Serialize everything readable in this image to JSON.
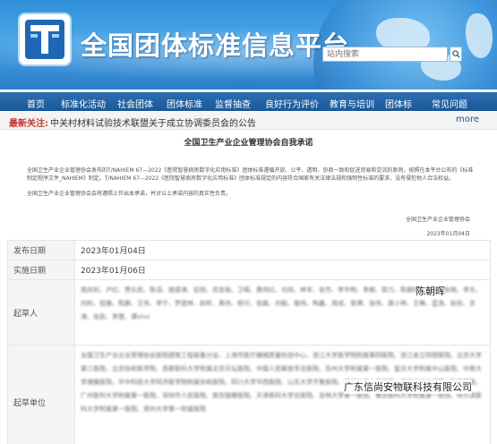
{
  "site": {
    "title": "全国团体标准信息平台",
    "search_placeholder": "站内搜索"
  },
  "nav": {
    "items": [
      "首页",
      "标准化活动",
      "社会团体",
      "团体标准",
      "监督抽查",
      "良好行为评价",
      "教育与培训",
      "团体标",
      "常见问题"
    ]
  },
  "notice": {
    "label": "最新关注:",
    "text": "中关村材料试验技术联盟关于成立协调委员会的公告",
    "more": "more"
  },
  "document": {
    "title": "全国卫生产业企业管理协会自我承诺",
    "paragraph1": "全国卫生产业企业管理协会发布的T/NAHIEM 67—2022《医院智慧病房数字化应用标准》团体标准遵循开放、公平、透明、协商一致和促进贸易和交流的原则，按照在本平台公布的《标准制定程序文件_NAHIEM》制定。T/NAHIEM 67—2022《医院智慧病房数字化应用标准》团体标准规定的内容符合国家有关法律法规和强制性标准的要求，没有侵犯他人合法权益。",
    "paragraph2": "全国卫生产业企业管理协会会将遵照上作出本承诺，并对以上承诺内容的真实性负责。",
    "signature": "全国卫生产业企业管理协会",
    "sign_date": "2023年01月04日"
  },
  "info": {
    "publish_label": "发布日期",
    "publish_date": "2023年01月04日",
    "implement_label": "实施日期",
    "implement_date": "2023年01月06日",
    "drafters_label": "起草人",
    "drafters_text": "周庆利、卢红、贾乐凯、陈滔、姚碧涛、彭刚、苏哲瑜、卫萌、黄伟红、刘凤、林军、张杰、李华明、李颖、郭力、陈朝晖、阚磊、赵晓、李东、刘利、倪雅、陈鹏、王伟、李宁、罗建林、赵昕、黄伟、杨可、张磊、刘毅、骆伟、陶鑫、周成、吴博、张伟、唐小林、王琳、蓝浩、赵彤、苏涛、张凯、李慧、谭vivv",
    "drafter_highlight": "陈朝晖",
    "units_label": "起草单位",
    "units_text": "全国卫生产业企业管理协会医院建筑工程装备分会、上海市医疗器械质量检验中心、浙江大学医学院附属第四医院、浙江省立同德医院、北京大学第三医院、北京协和医学院、首都医科大学附属北京天坛医院、中国人民解放军总医院、苏州大学附属第一医院、复旦大学附属中山医院、中南大学湘雅医院、华中科技大学同济医学院附属协和医院、四川大学华西医院、山东大学齐鲁医院、武汉大学人民医院、西安交通大学第一附属医院、广州医科大学附属第一医院、深圳市人民医院、南京鼓楼医院、天津医科大学总医院、吉林大学第一医院、重庆医科大学附属第一医院、哈尔滨医科大学附属第一医院、郑州大学第一附属医院",
    "unit_highlight": "广东信尚安物联科技有限公司"
  }
}
